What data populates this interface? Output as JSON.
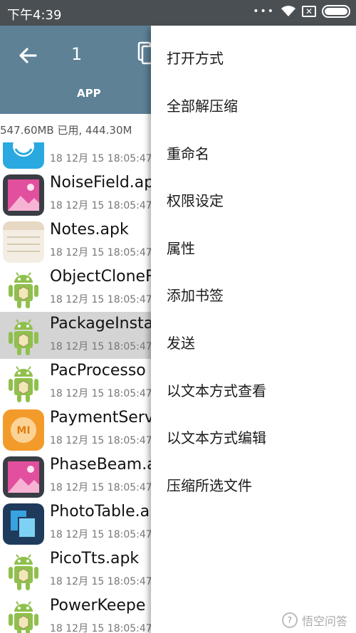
{
  "status_bar": {
    "time": "下午4:39",
    "icons": [
      "signal-dots-icon",
      "wifi-icon",
      "sim-x-icon",
      "battery-icon"
    ]
  },
  "app_bar": {
    "back_icon": "arrow-left-icon",
    "selected_count": "1",
    "copy_icon": "copy-icon",
    "tab_label": "APP",
    "color": "#5e8196"
  },
  "storage": {
    "text": "547.60MB 已用, 444.30M"
  },
  "files": [
    {
      "name": "",
      "meta": "18 12月 15 18:05:47",
      "icon": "blue-app-icon"
    },
    {
      "name": "NoiseField.ap",
      "meta": "18 12月 15 18:05:47",
      "icon": "gallery-icon"
    },
    {
      "name": "Notes.apk",
      "meta": "18 12月 15 18:05:47",
      "icon": "notes-icon"
    },
    {
      "name": "ObjectCloneR",
      "meta": "18 12月 15 18:05:47",
      "icon": "android-icon"
    },
    {
      "name": "PackageInsta",
      "meta": "18 12月 15 18:05:47",
      "icon": "android-icon",
      "selected": true
    },
    {
      "name": "PacProcesso",
      "meta": "18 12月 15 18:05:47",
      "icon": "android-icon"
    },
    {
      "name": "PaymentServ",
      "meta": "18 12月 15 18:05:47",
      "icon": "mi-icon"
    },
    {
      "name": "PhaseBeam.a",
      "meta": "18 12月 15 18:05:47",
      "icon": "gallery-icon"
    },
    {
      "name": "PhotoTable.a",
      "meta": "18 12月 15 18:05:47",
      "icon": "phototable-icon"
    },
    {
      "name": "PicoTts.apk",
      "meta": "18 12月 15 18:05:47",
      "icon": "android-icon"
    },
    {
      "name": "PowerKeepe",
      "meta": "18 12月 15 18:05:47",
      "icon": "android-icon"
    }
  ],
  "menu": {
    "items": [
      "打开方式",
      "全部解压缩",
      "重命名",
      "权限设定",
      "属性",
      "添加书签",
      "发送",
      "以文本方式查看",
      "以文本方式编辑",
      "压缩所选文件"
    ]
  },
  "watermark": {
    "text": "悟空问答"
  }
}
